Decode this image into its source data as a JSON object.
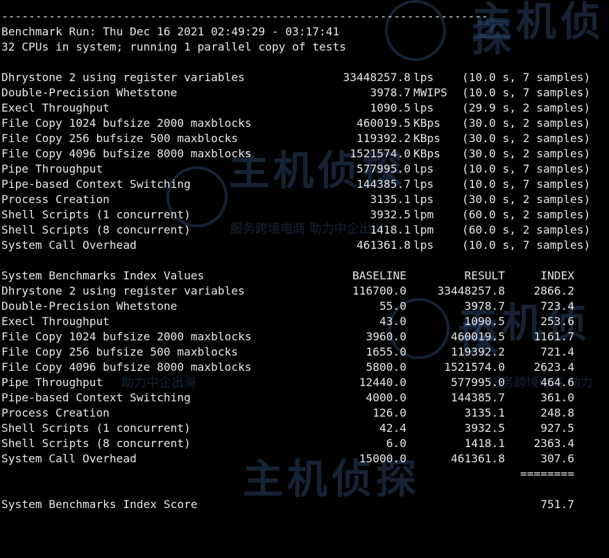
{
  "header": {
    "separator": "------------------------------------------------------------------------",
    "run": "Benchmark Run: Thu Dec 16 2021 02:49:29 - 03:17:41",
    "cpus": "32 CPUs in system; running 1 parallel copy of tests"
  },
  "results": [
    {
      "name": "Dhrystone 2 using register variables",
      "value": "33448257.8",
      "unit": "lps",
      "note": "(10.0 s, 7 samples)"
    },
    {
      "name": "Double-Precision Whetstone",
      "value": "3978.7",
      "unit": "MWIPS",
      "note": "(10.0 s, 7 samples)"
    },
    {
      "name": "Execl Throughput",
      "value": "1090.5",
      "unit": "lps",
      "note": "(29.9 s, 2 samples)"
    },
    {
      "name": "File Copy 1024 bufsize 2000 maxblocks",
      "value": "460019.5",
      "unit": "KBps",
      "note": "(30.0 s, 2 samples)"
    },
    {
      "name": "File Copy 256 bufsize 500 maxblocks",
      "value": "119392.2",
      "unit": "KBps",
      "note": "(30.0 s, 2 samples)"
    },
    {
      "name": "File Copy 4096 bufsize 8000 maxblocks",
      "value": "1521574.0",
      "unit": "KBps",
      "note": "(30.0 s, 2 samples)"
    },
    {
      "name": "Pipe Throughput",
      "value": "577995.0",
      "unit": "lps",
      "note": "(10.0 s, 7 samples)"
    },
    {
      "name": "Pipe-based Context Switching",
      "value": "144385.7",
      "unit": "lps",
      "note": "(10.0 s, 7 samples)"
    },
    {
      "name": "Process Creation",
      "value": "3135.1",
      "unit": "lps",
      "note": "(30.0 s, 2 samples)"
    },
    {
      "name": "Shell Scripts (1 concurrent)",
      "value": "3932.5",
      "unit": "lpm",
      "note": "(60.0 s, 2 samples)"
    },
    {
      "name": "Shell Scripts (8 concurrent)",
      "value": "1418.1",
      "unit": "lpm",
      "note": "(60.0 s, 2 samples)"
    },
    {
      "name": "System Call Overhead",
      "value": "461361.8",
      "unit": "lps",
      "note": "(10.0 s, 7 samples)"
    }
  ],
  "index": {
    "title": "System Benchmarks Index Values",
    "col_baseline": "BASELINE",
    "col_result": "RESULT",
    "col_index": "INDEX",
    "rows": [
      {
        "name": "Dhrystone 2 using register variables",
        "baseline": "116700.0",
        "result": "33448257.8",
        "index": "2866.2"
      },
      {
        "name": "Double-Precision Whetstone",
        "baseline": "55.0",
        "result": "3978.7",
        "index": "723.4"
      },
      {
        "name": "Execl Throughput",
        "baseline": "43.0",
        "result": "1090.5",
        "index": "253.6"
      },
      {
        "name": "File Copy 1024 bufsize 2000 maxblocks",
        "baseline": "3960.0",
        "result": "460019.5",
        "index": "1161.7"
      },
      {
        "name": "File Copy 256 bufsize 500 maxblocks",
        "baseline": "1655.0",
        "result": "119392.2",
        "index": "721.4"
      },
      {
        "name": "File Copy 4096 bufsize 8000 maxblocks",
        "baseline": "5800.0",
        "result": "1521574.0",
        "index": "2623.4"
      },
      {
        "name": "Pipe Throughput",
        "baseline": "12440.0",
        "result": "577995.0",
        "index": "464.6"
      },
      {
        "name": "Pipe-based Context Switching",
        "baseline": "4000.0",
        "result": "144385.7",
        "index": "361.0"
      },
      {
        "name": "Process Creation",
        "baseline": "126.0",
        "result": "3135.1",
        "index": "248.8"
      },
      {
        "name": "Shell Scripts (1 concurrent)",
        "baseline": "42.4",
        "result": "3932.5",
        "index": "927.5"
      },
      {
        "name": "Shell Scripts (8 concurrent)",
        "baseline": "6.0",
        "result": "1418.1",
        "index": "2363.4"
      },
      {
        "name": "System Call Overhead",
        "baseline": "15000.0",
        "result": "461361.8",
        "index": "307.6"
      }
    ],
    "underline": "========",
    "score_label": "System Benchmarks Index Score",
    "score": "751.7"
  },
  "watermark": {
    "brand": "主机侦探",
    "slogan1": "服务跨境电商 助力中企出海",
    "slogan2": "助力中企出海",
    "slogan3": "服务跨境电商 助力"
  }
}
